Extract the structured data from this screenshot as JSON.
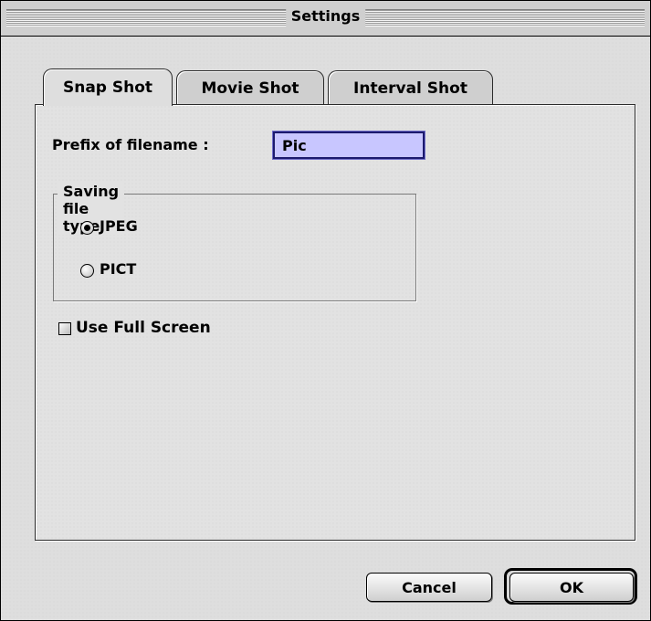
{
  "window": {
    "title": "Settings"
  },
  "tabs": [
    {
      "label": "Snap Shot",
      "active": true
    },
    {
      "label": "Movie Shot",
      "active": false
    },
    {
      "label": "Interval Shot",
      "active": false
    }
  ],
  "form": {
    "prefix_label": "Prefix of filename :",
    "prefix_value": "Pic",
    "saving_group_title": "Saving file type",
    "file_types": [
      {
        "label": "JPEG",
        "selected": true
      },
      {
        "label": "PICT",
        "selected": false
      }
    ],
    "full_screen_label": "Use Full Screen",
    "full_screen_checked": false
  },
  "buttons": {
    "cancel": "Cancel",
    "ok": "OK"
  },
  "colors": {
    "input_fill": "#c8c6ff",
    "window_bg": "#dedede"
  }
}
